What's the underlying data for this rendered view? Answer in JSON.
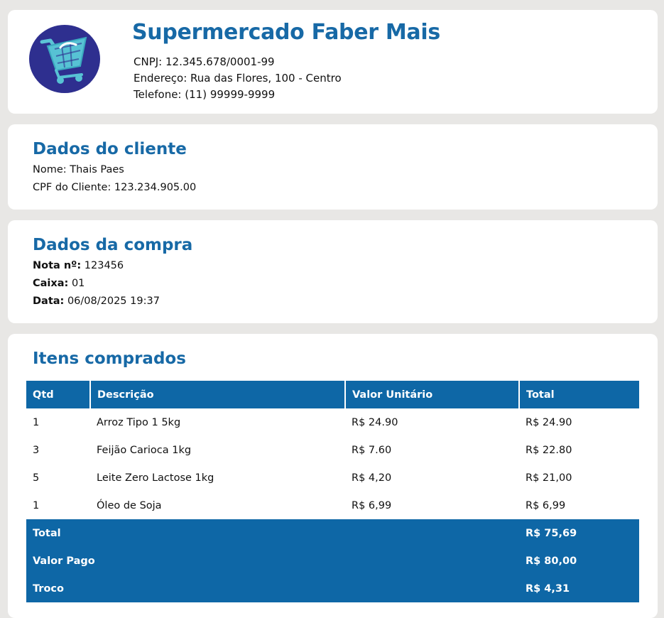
{
  "store": {
    "name": "Supermercado Faber Mais",
    "cnpj": "CNPJ: 12.345.678/0001-99",
    "address": "Endereço: Rua das Flores, 100 - Centro",
    "phone": "Telefone: (11) 99999-9999",
    "logo_icon": "shopping-cart-icon",
    "logo_color": "#2e2f8f"
  },
  "client": {
    "title": "Dados do cliente",
    "name": "Nome: Thais Paes",
    "cpf": "CPF do Cliente: 123.234.905.00"
  },
  "purchase": {
    "title": "Dados da compra",
    "note_label": "Nota nº:",
    "note_value": "123456",
    "register_label": "Caixa:",
    "register_value": "01",
    "date_label": "Data:",
    "date_value": "06/08/2025 19:37"
  },
  "items": {
    "title": "Itens comprados",
    "headers": [
      "Qtd",
      "Descrição",
      "Valor Unitário",
      "Total"
    ],
    "rows": [
      {
        "qty": "1",
        "desc": "Arroz Tipo 1 5kg",
        "unit": "R$ 24.90",
        "total": "R$ 24.90"
      },
      {
        "qty": "3",
        "desc": "Feijão Carioca 1kg",
        "unit": "R$ 7.60",
        "total": "R$ 22.80"
      },
      {
        "qty": "5",
        "desc": "Leite Zero Lactose 1kg",
        "unit": "R$ 4,20",
        "total": "R$ 21,00"
      },
      {
        "qty": "1",
        "desc": "Óleo de Soja",
        "unit": "R$ 6,99",
        "total": "R$ 6,99"
      }
    ],
    "summary": [
      {
        "label": "Total",
        "value": "R$ 75,69"
      },
      {
        "label": "Valor Pago",
        "value": "R$ 80,00"
      },
      {
        "label": "Troco",
        "value": "R$ 4,31"
      }
    ]
  },
  "colors": {
    "accent": "#1769a6",
    "table_header": "#0e67a6",
    "background": "#e8e7e5"
  }
}
